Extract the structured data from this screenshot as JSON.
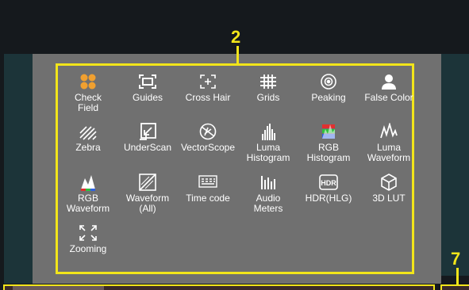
{
  "callouts": {
    "panel_number": "2",
    "side_number": "7"
  },
  "colors": {
    "highlight": "#f2e51a",
    "panel_bg": "#707070",
    "accent_orange": "#f0a030"
  },
  "menu": {
    "items": [
      {
        "label": "Check\nField",
        "icon": "check-field-icon"
      },
      {
        "label": "Guides",
        "icon": "guides-icon"
      },
      {
        "label": "Cross Hair",
        "icon": "cross-hair-icon"
      },
      {
        "label": "Grids",
        "icon": "grids-icon"
      },
      {
        "label": "Peaking",
        "icon": "peaking-icon"
      },
      {
        "label": "False Color",
        "icon": "false-color-icon"
      },
      {
        "label": "Zebra",
        "icon": "zebra-icon"
      },
      {
        "label": "UnderScan",
        "icon": "underscan-icon"
      },
      {
        "label": "VectorScope",
        "icon": "vectorscope-icon"
      },
      {
        "label": "Luma\nHistogram",
        "icon": "luma-histogram-icon"
      },
      {
        "label": "RGB\nHistogram",
        "icon": "rgb-histogram-icon"
      },
      {
        "label": "Luma\nWaveform",
        "icon": "luma-waveform-icon"
      },
      {
        "label": "RGB\nWaveform",
        "icon": "rgb-waveform-icon"
      },
      {
        "label": "Waveform\n(All)",
        "icon": "waveform-all-icon"
      },
      {
        "label": "Time code",
        "icon": "time-code-icon"
      },
      {
        "label": "Audio\nMeters",
        "icon": "audio-meters-icon"
      },
      {
        "label": "HDR(HLG)",
        "icon": "hdr-hlg-icon"
      },
      {
        "label": "3D LUT",
        "icon": "3d-lut-icon"
      },
      {
        "label": "Zooming",
        "icon": "zooming-icon"
      }
    ]
  }
}
